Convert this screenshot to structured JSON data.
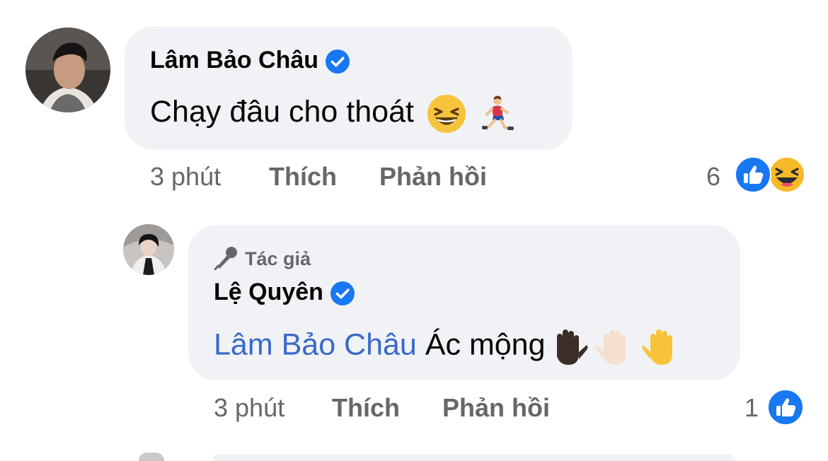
{
  "comments": [
    {
      "author": "Lâm Bảo Châu",
      "verified": true,
      "text": "Chạy đâu cho thoát",
      "emojis": [
        "grinning-squinting-face",
        "person-running"
      ],
      "time": "3 phút",
      "like_label": "Thích",
      "reply_label": "Phản hồi",
      "reaction_count": "6",
      "reactions": [
        "like",
        "haha"
      ]
    },
    {
      "badge": "Tác giả",
      "author": "Lệ Quyên",
      "verified": true,
      "mention": "Lâm Bảo Châu",
      "text": "Ác mộng",
      "emojis": [
        "raised-hand-dark",
        "raised-hand-light",
        "raised-hand-yellow"
      ],
      "time": "3 phút",
      "like_label": "Thích",
      "reply_label": "Phản hồi",
      "reaction_count": "1",
      "reactions": [
        "like"
      ]
    }
  ],
  "colors": {
    "bubble": "#f0f2f5",
    "mention": "#3b69c9",
    "verified": "#1877f2",
    "meta": "#65676b"
  }
}
